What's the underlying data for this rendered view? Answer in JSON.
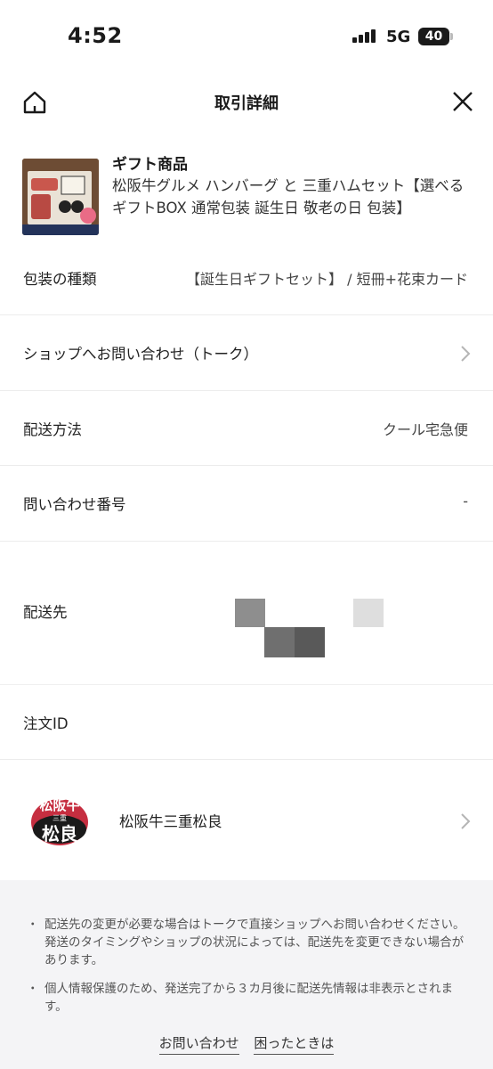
{
  "status_bar": {
    "time": "4:52",
    "network": "5G",
    "battery": "40"
  },
  "header": {
    "title": "取引詳細"
  },
  "product": {
    "kind": "ギフト商品",
    "name": "松阪牛グルメ ハンバーグ と 三重ハムセット【選べるギフトBOX 通常包装 誕生日 敬老の日 包装】"
  },
  "rows": {
    "packaging": {
      "label": "包装の種類",
      "value": "【誕生日ギフトセット】 / 短冊+花束カード"
    },
    "contact": {
      "label": "ショップへお問い合わせ（トーク）"
    },
    "shipping": {
      "label": "配送方法",
      "value": "クール宅急便"
    },
    "inquiry": {
      "label": "問い合わせ番号",
      "value": "-"
    },
    "destination": {
      "label": "配送先"
    },
    "order_id": {
      "label": "注文ID"
    },
    "shop": {
      "name": "松阪牛三重松良",
      "logo_text": "松阪牛 三重 松良"
    }
  },
  "notices": [
    "配送先の変更が必要な場合はトークで直接ショップへお問い合わせください。発送のタイミングやショップの状況によっては、配送先を変更できない場合があります。",
    "個人情報保護のため、発送完了から３カ月後に配送先情報は非表示とされます。"
  ],
  "notice_bullet": "・",
  "footer": {
    "contact_link": "お問い合わせ",
    "help_link": "困ったときは"
  },
  "colors": {
    "text": "#1a1a1a",
    "secondary": "#444444",
    "divider": "#ececec",
    "footer_bg": "#f4f4f6",
    "logo_red": "#c0172b"
  }
}
